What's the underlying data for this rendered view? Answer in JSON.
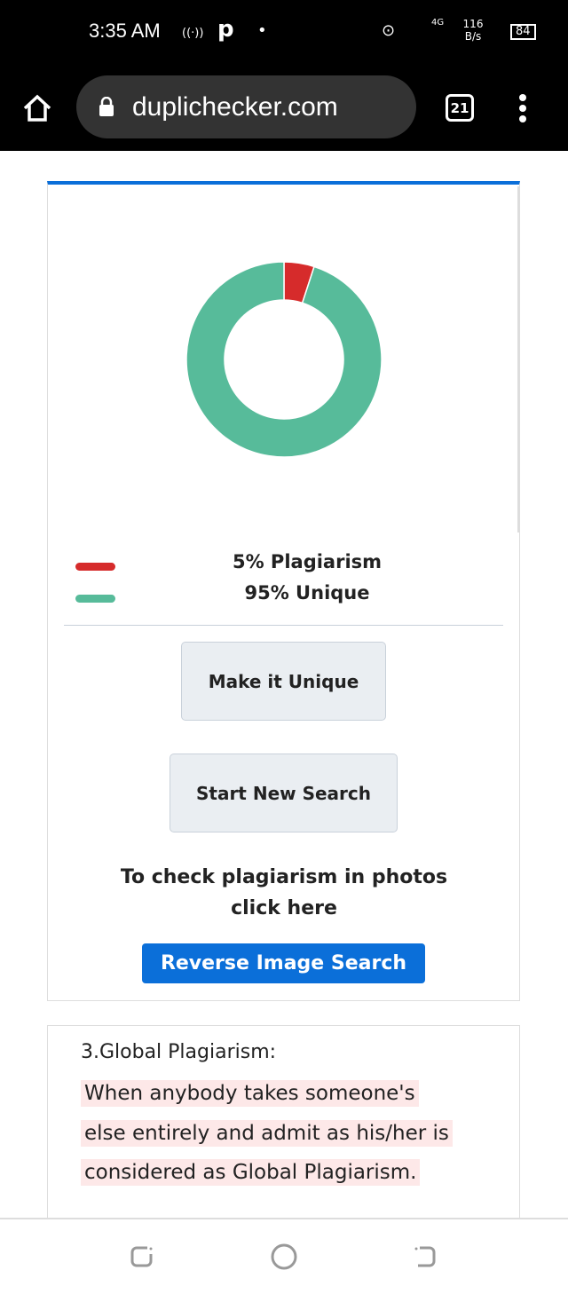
{
  "status_bar": {
    "time": "3:35 AM",
    "network": "4G",
    "speed": "116 B/s",
    "battery": "84"
  },
  "browser": {
    "url": "duplichecker.com",
    "tab_count": "21"
  },
  "chart_data": {
    "type": "pie",
    "donut": true,
    "categories": [
      "Plagiarism",
      "Unique"
    ],
    "values": [
      5,
      95
    ],
    "colors": [
      "#d62b2b",
      "#57bb9a"
    ]
  },
  "result": {
    "plagiarism_label": "5% Plagiarism",
    "unique_label": "95% Unique",
    "make_unique": "Make it Unique",
    "new_search": "Start New Search",
    "photo_text_1": "To check plagiarism in photos",
    "photo_text_2": "click here",
    "reverse_image": "Reverse Image Search"
  },
  "article": {
    "heading": "3.Global Plagiarism:",
    "lines": [
      "When anybody takes someone's",
      "else entirely and admit as his/her is",
      "considered as Global Plagiarism."
    ]
  }
}
